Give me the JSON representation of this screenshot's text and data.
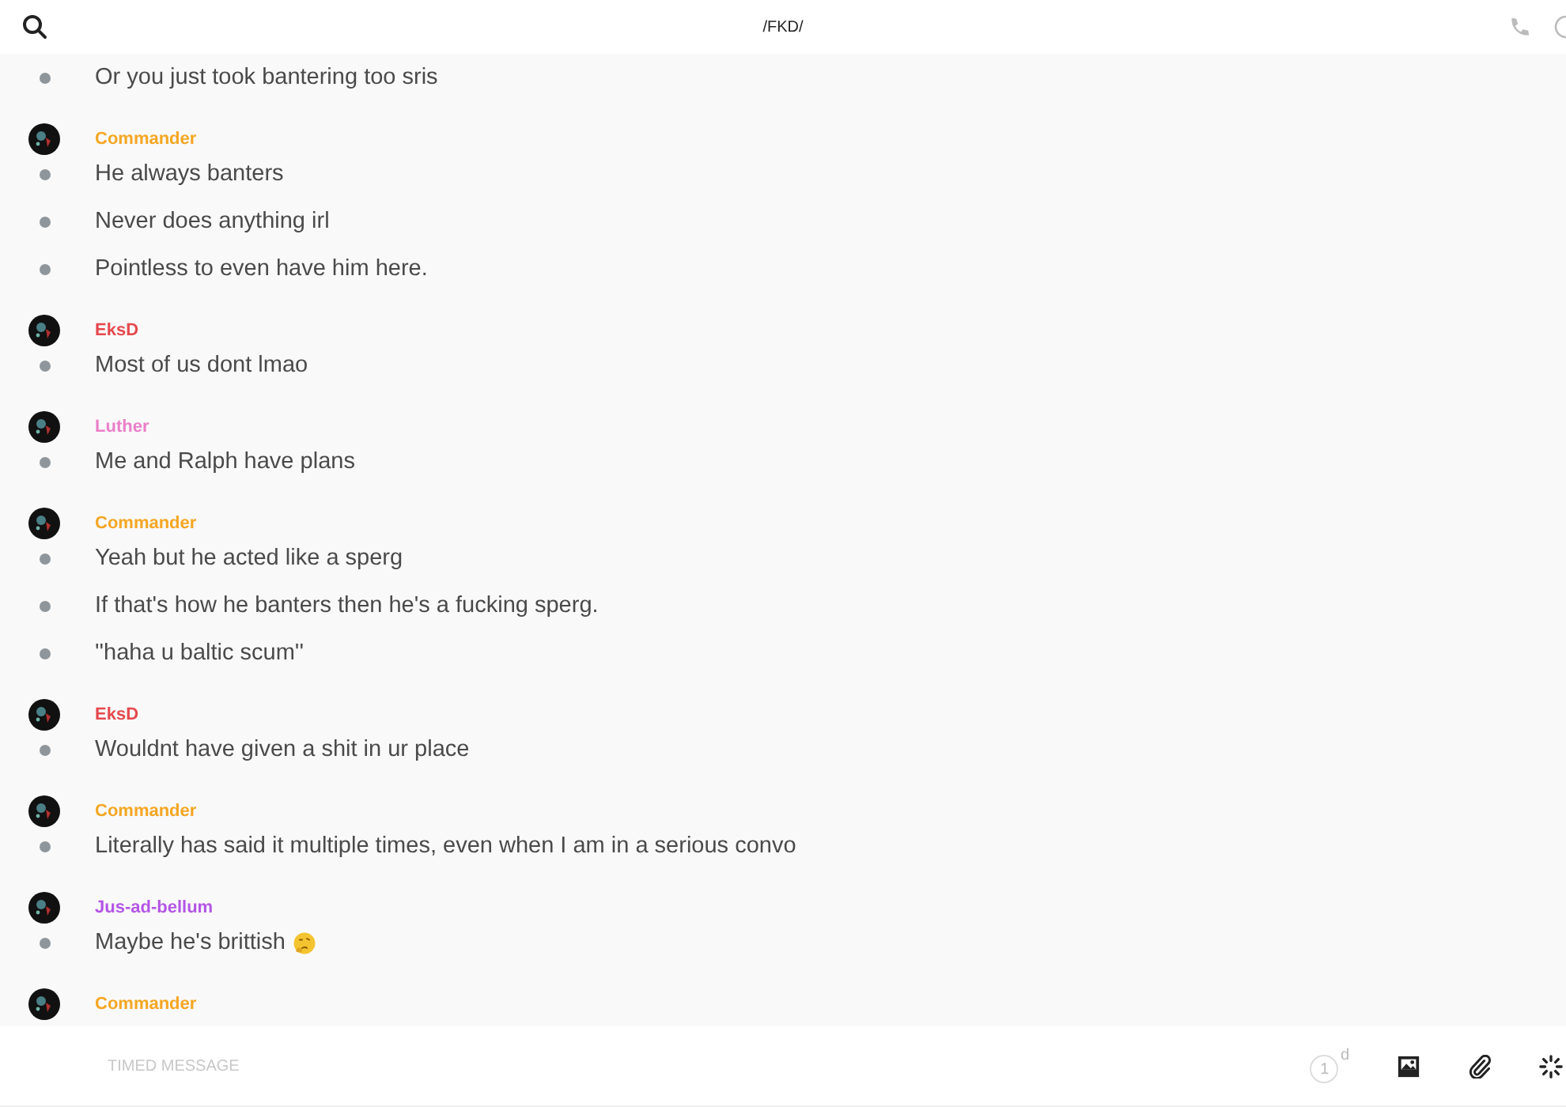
{
  "header": {
    "title": "/FKD/"
  },
  "groups": [
    {
      "messages": [
        {
          "text": "Or you just took bantering too sris"
        }
      ]
    },
    {
      "author": "Commander",
      "color": "#f5a623",
      "messages": [
        {
          "text": "He always banters"
        },
        {
          "text": "Never does anything irl"
        },
        {
          "text": "Pointless to even have him here."
        }
      ]
    },
    {
      "author": "EksD",
      "color": "#e5484d",
      "messages": [
        {
          "text": "Most of us dont lmao"
        }
      ]
    },
    {
      "author": "Luther",
      "color": "#ea7fc9",
      "messages": [
        {
          "text": "Me and Ralph have plans"
        }
      ]
    },
    {
      "author": "Commander",
      "color": "#f5a623",
      "messages": [
        {
          "text": "Yeah but he acted like a sperg"
        },
        {
          "text": "If that's how he banters then he's a fucking sperg."
        },
        {
          "text": "''haha u baltic scum''"
        }
      ]
    },
    {
      "author": "EksD",
      "color": "#e5484d",
      "messages": [
        {
          "text": "Wouldnt have given a shit in ur place"
        }
      ]
    },
    {
      "author": "Commander",
      "color": "#f5a623",
      "messages": [
        {
          "text": "Literally has said it multiple times, even when I am in a serious convo"
        }
      ]
    },
    {
      "author": "Jus-ad-bellum",
      "color": "#b455e6",
      "messages": [
        {
          "text": "Maybe he's brittish",
          "emoji": true
        }
      ]
    },
    {
      "author": "Commander",
      "color": "#f5a623"
    }
  ],
  "composer": {
    "placeholder": "TIMED MESSAGE",
    "timer": {
      "value": "1",
      "unit": "d"
    }
  }
}
